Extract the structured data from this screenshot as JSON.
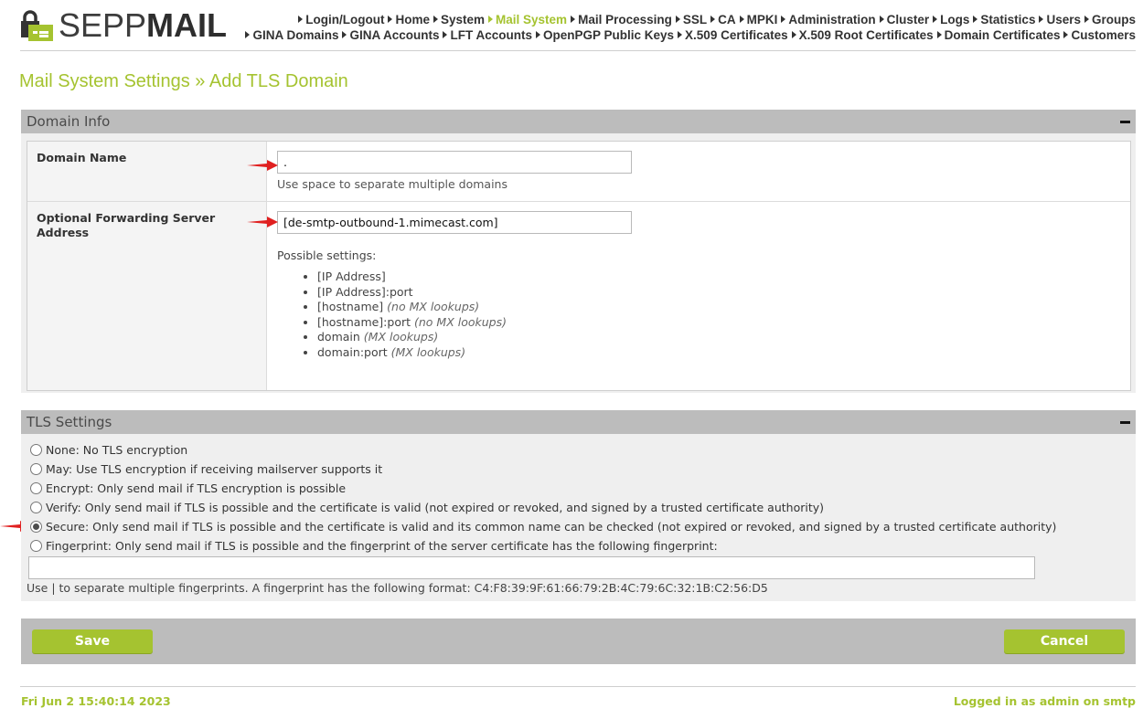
{
  "logo": {
    "light": "SEPP",
    "bold": "MAIL"
  },
  "nav": {
    "row1": [
      "Login/Logout",
      "Home",
      "System",
      "Mail System",
      "Mail Processing",
      "SSL",
      "CA",
      "MPKI",
      "Administration",
      "Cluster",
      "Logs",
      "Statistics",
      "Users",
      "Groups"
    ],
    "row2": [
      "GINA Domains",
      "GINA Accounts",
      "LFT Accounts",
      "OpenPGP Public Keys",
      "X.509 Certificates",
      "X.509 Root Certificates",
      "Domain Certificates",
      "Customers"
    ],
    "active": "Mail System"
  },
  "breadcrumb": {
    "parent": "Mail System Settings",
    "separator": "»",
    "current": "Add TLS Domain"
  },
  "domain_info": {
    "title": "Domain Info",
    "domain_name": {
      "label": "Domain Name",
      "value": ".",
      "help": "Use space to separate multiple domains"
    },
    "forwarding": {
      "label": "Optional Forwarding Server Address",
      "value": "[de-smtp-outbound-1.mimecast.com]",
      "possible_label": "Possible settings:",
      "options": [
        {
          "text": "[IP Address]",
          "note": ""
        },
        {
          "text": "[IP Address]:port",
          "note": ""
        },
        {
          "text": "[hostname] ",
          "note": "(no MX lookups)"
        },
        {
          "text": "[hostname]:port ",
          "note": "(no MX lookups)"
        },
        {
          "text": "domain ",
          "note": "(MX lookups)"
        },
        {
          "text": "domain:port ",
          "note": "(MX lookups)"
        }
      ]
    }
  },
  "tls_settings": {
    "title": "TLS Settings",
    "options": [
      {
        "label": "None: No TLS encryption",
        "checked": false
      },
      {
        "label": "May: Use TLS encryption if receiving mailserver supports it",
        "checked": false
      },
      {
        "label": "Encrypt: Only send mail if TLS encryption is possible",
        "checked": false
      },
      {
        "label": "Verify: Only send mail if TLS is possible and the certificate is valid (not expired or revoked, and signed by a trusted certificate authority)",
        "checked": false
      },
      {
        "label": "Secure: Only send mail if TLS is possible and the certificate is valid and its common name can be checked (not expired or revoked, and signed by a trusted certificate authority)",
        "checked": true
      },
      {
        "label": "Fingerprint: Only send mail if TLS is possible and the fingerprint of the server certificate has the following fingerprint:",
        "checked": false
      }
    ],
    "fingerprint_value": "",
    "fingerprint_help": "Use | to separate multiple fingerprints. A fingerprint has the following format: C4:F8:39:9F:61:66:79:2B:4C:79:6C:32:1B:C2:56:D5"
  },
  "buttons": {
    "save": "Save",
    "cancel": "Cancel"
  },
  "footer": {
    "timestamp": "Fri Jun 2 15:40:14 2023",
    "login_status": "Logged in as admin on smtp"
  },
  "colors": {
    "accent": "#a5c330",
    "section_header": "#bcbcbc",
    "arrow": "#e02020"
  }
}
